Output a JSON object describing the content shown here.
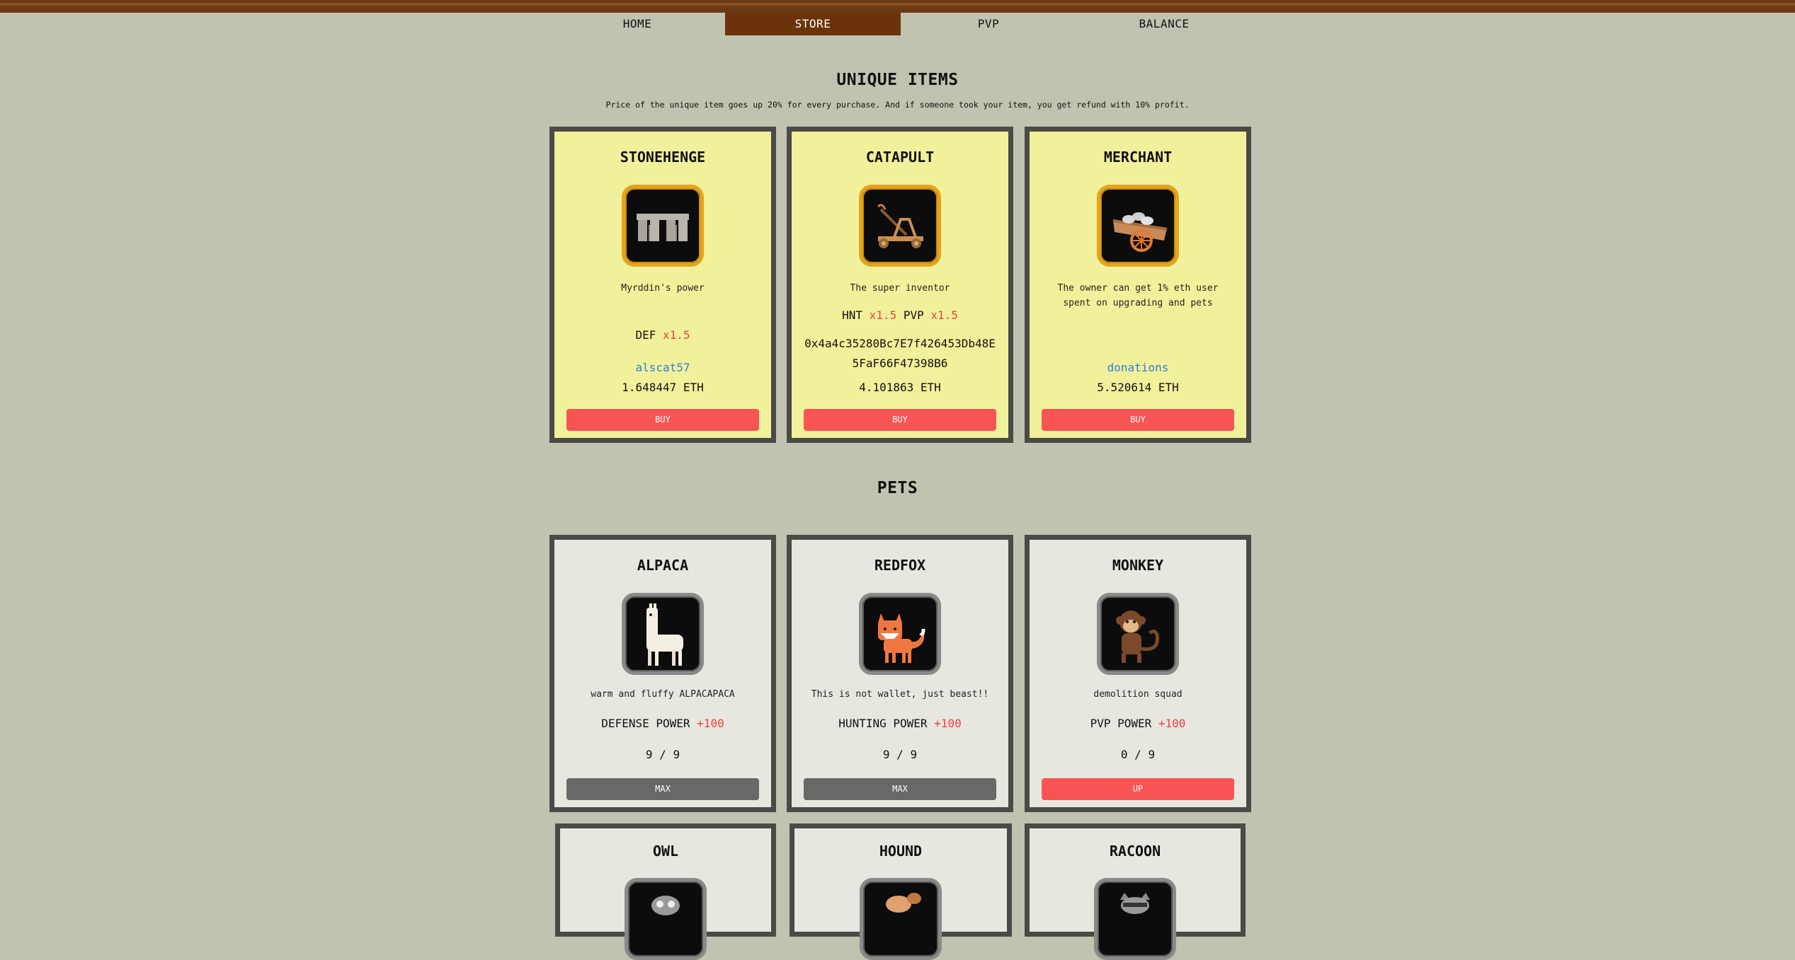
{
  "nav": {
    "home": "HOME",
    "store": "STORE",
    "pvp": "PVP",
    "balance": "BALANCE"
  },
  "unique": {
    "title": "UNIQUE ITEMS",
    "subtitle": "Price of the unique item goes up 20% for every purchase. And if someone took your item, you get refund with 10% profit.",
    "items": [
      {
        "name": "STONEHENGE",
        "icon": "stonehenge-icon",
        "desc": "Myrddin's power",
        "stat1_label": "DEF",
        "stat1_mult": "x1.5",
        "owner": "alscat57",
        "price": "1.648447 ETH",
        "button": "BUY"
      },
      {
        "name": "CATAPULT",
        "icon": "catapult-icon",
        "desc": "The super inventor",
        "stat1_label": "HNT",
        "stat1_mult": "x1.5",
        "stat2_label": "PVP",
        "stat2_mult": "x1.5",
        "owner": "0x4a4c35280Bc7E7f426453Db48E5FaF66F47398B6",
        "price": "4.101863 ETH",
        "button": "BUY"
      },
      {
        "name": "MERCHANT",
        "icon": "merchant-cart-icon",
        "desc": "The owner can get 1% eth user spent on upgrading and pets",
        "owner": "donations",
        "price": "5.520614 ETH",
        "button": "BUY"
      }
    ]
  },
  "pets": {
    "title": "PETS",
    "items": [
      {
        "name": "ALPACA",
        "icon": "alpaca-icon",
        "desc": "warm and fluffy ALPACAPACA",
        "power_label": "DEFENSE POWER",
        "power_value": "+100",
        "level": "9 / 9",
        "level_fraction": 1.0,
        "button": "MAX"
      },
      {
        "name": "REDFOX",
        "icon": "redfox-icon",
        "desc": "This is not wallet, just beast!!",
        "power_label": "HUNTING POWER",
        "power_value": "+100",
        "level": "9 / 9",
        "level_fraction": 1.0,
        "button": "MAX"
      },
      {
        "name": "MONKEY",
        "icon": "monkey-icon",
        "desc": "demolition squad",
        "power_label": "PVP POWER",
        "power_value": "+100",
        "level": "0 / 9",
        "level_fraction": 0.0,
        "button": "UP"
      },
      {
        "name": "OWL",
        "icon": "owl-icon"
      },
      {
        "name": "HOUND",
        "icon": "hound-icon"
      },
      {
        "name": "RACOON",
        "icon": "racoon-icon"
      }
    ]
  },
  "colors": {
    "background": "#c1c3b0",
    "nav_active": "#6b3309",
    "item_card": "#f2f19b",
    "pet_card": "#e7e7e0",
    "buy_button": "#f95454",
    "max_button": "#686866",
    "accent_red": "#ee3f3f",
    "link_blue": "#2f7fd6"
  }
}
